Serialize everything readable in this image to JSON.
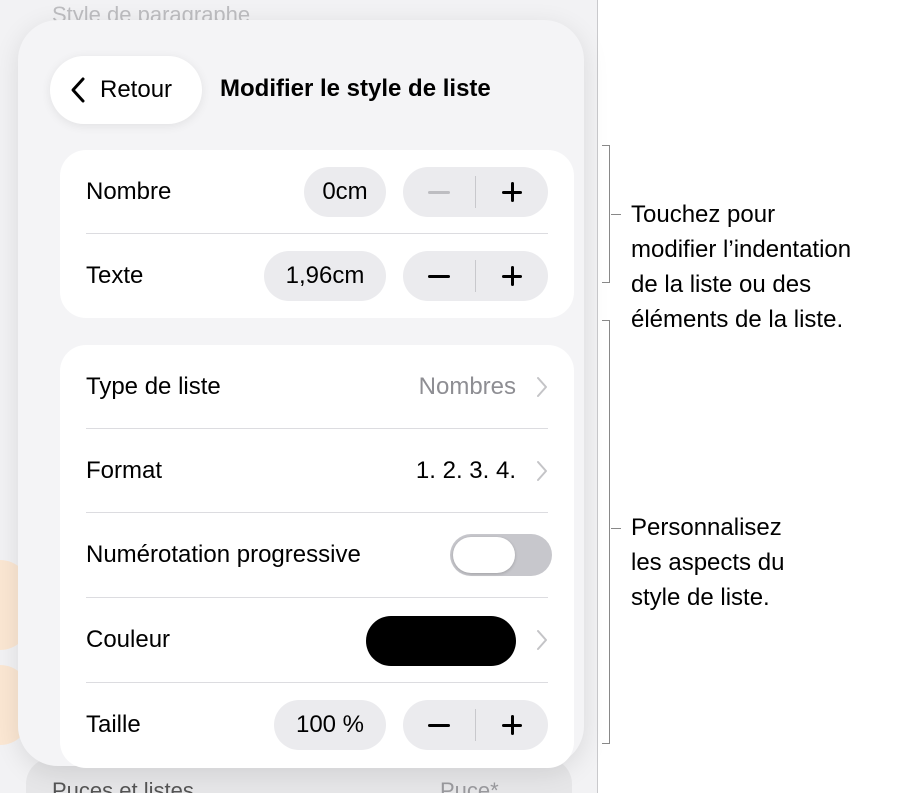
{
  "background": {
    "heading": "Style de paragraphe",
    "bottom_row_label": "Puces et listes",
    "bottom_row_value": "Puce*"
  },
  "popover": {
    "back_label": "Retour",
    "title": "Modifier le style de liste",
    "indentation": {
      "rows": [
        {
          "label": "Nombre",
          "value": "0cm",
          "minus_enabled": false
        },
        {
          "label": "Texte",
          "value": "1,96cm",
          "minus_enabled": true
        }
      ]
    },
    "style": {
      "list_type": {
        "label": "Type de liste",
        "value": "Nombres",
        "value_color": "#8e8e93"
      },
      "format": {
        "label": "Format",
        "value": "1. 2. 3. 4.",
        "value_color": "#000000"
      },
      "progressive": {
        "label": "Numérotation progressive",
        "on": false
      },
      "color": {
        "label": "Couleur",
        "swatch": "#000000"
      },
      "size": {
        "label": "Taille",
        "value": "100 %"
      }
    }
  },
  "callouts": {
    "indentation": [
      "Touchez pour",
      "modifier l’indentation",
      "de la liste ou des",
      "éléments de la liste."
    ],
    "style": [
      "Personnalisez",
      "les aspects du",
      "style de liste."
    ]
  }
}
